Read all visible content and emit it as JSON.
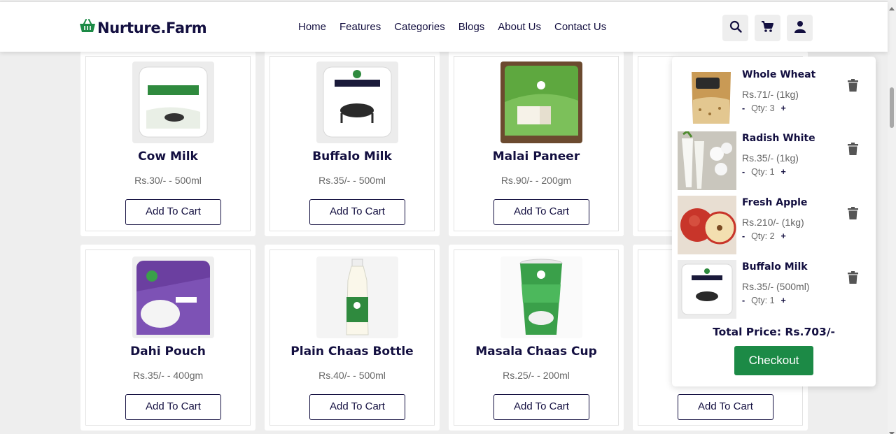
{
  "brand": {
    "name": "Nurture.Farm"
  },
  "nav": [
    "Home",
    "Features",
    "Categories",
    "Blogs",
    "About Us",
    "Contact Us"
  ],
  "header_icons": [
    "search-icon",
    "cart-icon",
    "user-icon"
  ],
  "products": [
    {
      "name": "Cow Milk",
      "price": "Rs.30/- - 500ml",
      "button": "Add To Cart"
    },
    {
      "name": "Buffalo Milk",
      "price": "Rs.35/- - 500ml",
      "button": "Add To Cart"
    },
    {
      "name": "Malai Paneer",
      "price": "Rs.90/- - 200gm",
      "button": "Add To Cart"
    },
    {
      "name": "Dahi Pouch",
      "price": "Rs.35/- - 400gm",
      "button": "Add To Cart"
    },
    {
      "name": "Plain Chaas Bottle",
      "price": "Rs.40/- - 500ml",
      "button": "Add To Cart"
    },
    {
      "name": "Masala Chaas Cup",
      "price": "Rs.25/- - 200ml",
      "button": "Add To Cart"
    },
    {
      "button": "Add To Cart"
    }
  ],
  "cart": {
    "items": [
      {
        "name": "Whole Wheat",
        "price": "Rs.71/- (1kg)",
        "minus": "-",
        "qty": "Qty: 3",
        "plus": "+"
      },
      {
        "name": "Radish White",
        "price": "Rs.35/- (1kg)",
        "minus": "-",
        "qty": "Qty: 1",
        "plus": "+"
      },
      {
        "name": "Fresh Apple",
        "price": "Rs.210/- (1kg)",
        "minus": "-",
        "qty": "Qty: 2",
        "plus": "+"
      },
      {
        "name": "Buffalo Milk",
        "price": "Rs.35/- (500ml)",
        "minus": "-",
        "qty": "Qty: 1",
        "plus": "+"
      }
    ],
    "total": "Total Price: Rs.703/-",
    "checkout": "Checkout"
  },
  "colors": {
    "primary": "#130f40",
    "accent": "#1c8a46",
    "background": "#eeeeee"
  }
}
